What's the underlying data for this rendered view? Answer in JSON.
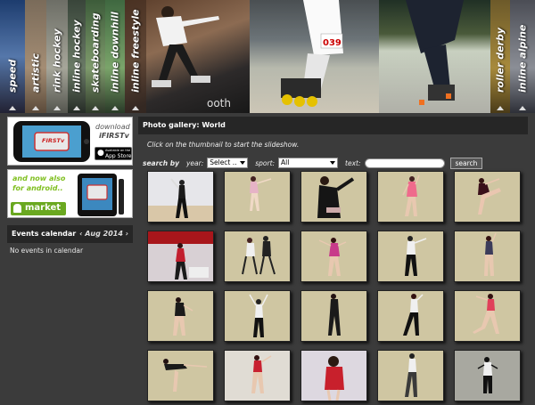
{
  "banner": {
    "sports": [
      "speed",
      "artistic",
      "rink hockey",
      "inline hockey",
      "skateboarding",
      "inline downhill",
      "inline freestyle",
      "roller derby",
      "inline alpine"
    ],
    "bib_number": "039"
  },
  "promo_ios": {
    "line1": "download",
    "line2": "iFIRSTv",
    "store": "App Store",
    "store_small": "Available on the",
    "tv": "FIRSTv"
  },
  "promo_android": {
    "line1": "and now also",
    "line2": "for android..",
    "market": "market"
  },
  "calendar": {
    "title": "Events calendar",
    "prev": "‹",
    "month": "Aug 2014",
    "next": "›",
    "empty": "No events in calendar"
  },
  "gallery": {
    "title": "Photo gallery: World",
    "hint": "Click on the thumbnail to start the slideshow.",
    "search_by": "search by",
    "year_label": "year:",
    "year_value": "Select ..",
    "sport_label": "sport:",
    "sport_value": "All",
    "text_label": "text:",
    "search_button": "search",
    "thumbnails": 20
  },
  "colors": {
    "background": "#3b3b3b",
    "header": "#262626",
    "floor": "#cfc6a2"
  }
}
